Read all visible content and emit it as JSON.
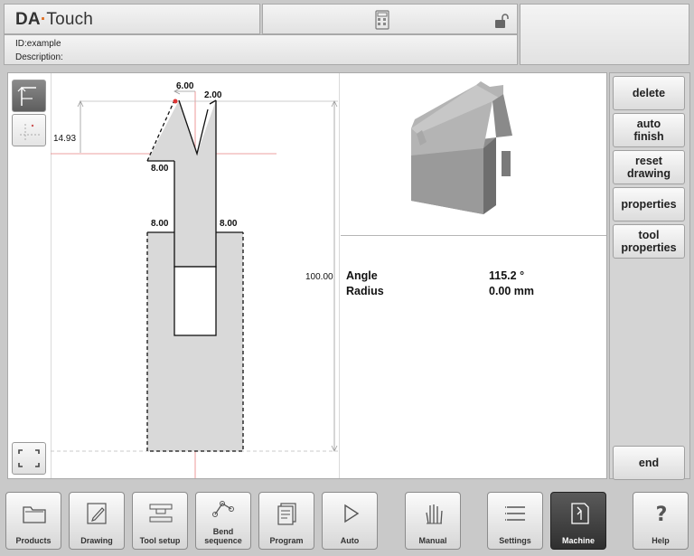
{
  "header": {
    "logo_brand": "DA",
    "logo_sep": "·",
    "logo_product": "Touch",
    "id_line": "ID:example",
    "description_line": "Description:"
  },
  "drawing": {
    "dim_top_width": "6.00",
    "dim_top_right": "2.00",
    "dim_height_small": "14.93",
    "dim_step_left": "8.00",
    "dim_body_left": "8.00",
    "dim_body_right": "8.00",
    "dim_total_height": "100.00"
  },
  "properties": {
    "angle_label": "Angle",
    "angle_value": "115.2 °",
    "radius_label": "Radius",
    "radius_value": "0.00 mm"
  },
  "sidebar": {
    "delete": "delete",
    "auto_finish": "auto\nfinish",
    "reset_drawing": "reset\ndrawing",
    "properties": "properties",
    "tool_properties": "tool\nproperties",
    "end": "end"
  },
  "nav": {
    "products": "Products",
    "drawing": "Drawing",
    "tool_setup": "Tool setup",
    "bend_sequence": "Bend\nsequence",
    "program": "Program",
    "auto": "Auto",
    "manual": "Manual",
    "settings": "Settings",
    "machine": "Machine",
    "help": "Help"
  },
  "colors": {
    "accent": "#e06a1a",
    "tool_fill": "#d9d9d9",
    "reference_line": "#e88080",
    "active_tab": "#3a3a3a"
  },
  "icons": [
    "folder-icon",
    "pencil-icon",
    "tool-setup-icon",
    "bend-sequence-icon",
    "program-icon",
    "play-icon",
    "hand-icon",
    "settings-list-icon",
    "machine-icon",
    "help-icon",
    "calculator-icon",
    "unlock-icon"
  ]
}
